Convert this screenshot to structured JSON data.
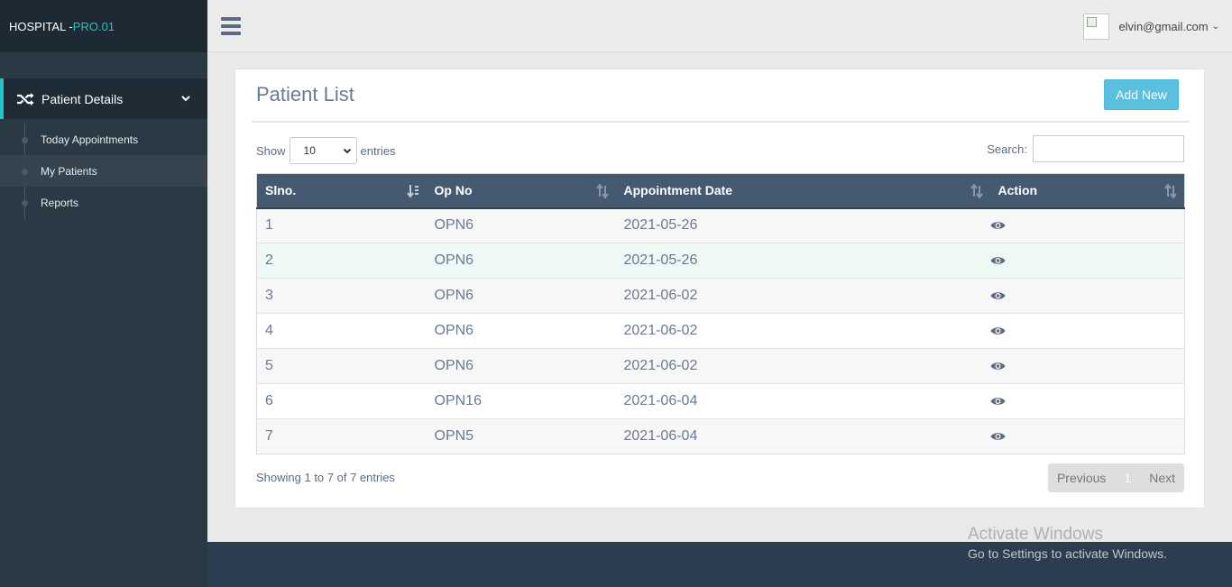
{
  "brand": {
    "name": "HOSPITAL - ",
    "suffix": "PRO.01"
  },
  "sidebar": {
    "section": {
      "label": "Patient Details",
      "icon": "shuffle-icon"
    },
    "items": [
      {
        "label": "Today Appointments"
      },
      {
        "label": "My Patients",
        "active": true
      },
      {
        "label": "Reports"
      }
    ]
  },
  "header": {
    "user_email": "elvin@gmail.com",
    "user_chevron": "⌄"
  },
  "main": {
    "title": "Patient List",
    "add_button": "Add New",
    "show_label": "Show",
    "entries_label": "entries",
    "page_size": "10",
    "search_label": "Search:",
    "search_value": ""
  },
  "table": {
    "columns": [
      "Slno.",
      "Op No",
      "Appointment Date",
      "Action"
    ],
    "rows": [
      [
        "1",
        "OPN6",
        "2021-05-26"
      ],
      [
        "2",
        "OPN6",
        "2021-05-26"
      ],
      [
        "3",
        "OPN6",
        "2021-06-02"
      ],
      [
        "4",
        "OPN6",
        "2021-06-02"
      ],
      [
        "5",
        "OPN6",
        "2021-06-02"
      ],
      [
        "6",
        "OPN16",
        "2021-06-04"
      ],
      [
        "7",
        "OPN5",
        "2021-06-04"
      ]
    ]
  },
  "pagination": {
    "info": "Showing 1 to 7 of 7 entries",
    "previous": "Previous",
    "page": "1",
    "next": "Next"
  },
  "watermark": {
    "line1": "Activate Windows",
    "line2": "Go to Settings to activate Windows."
  },
  "colors": {
    "accent": "#1fc7c7",
    "sidebar": "#2a3a45",
    "table_header": "#455a70",
    "add_button": "#5bc0de",
    "footer": "#2c3d52"
  }
}
